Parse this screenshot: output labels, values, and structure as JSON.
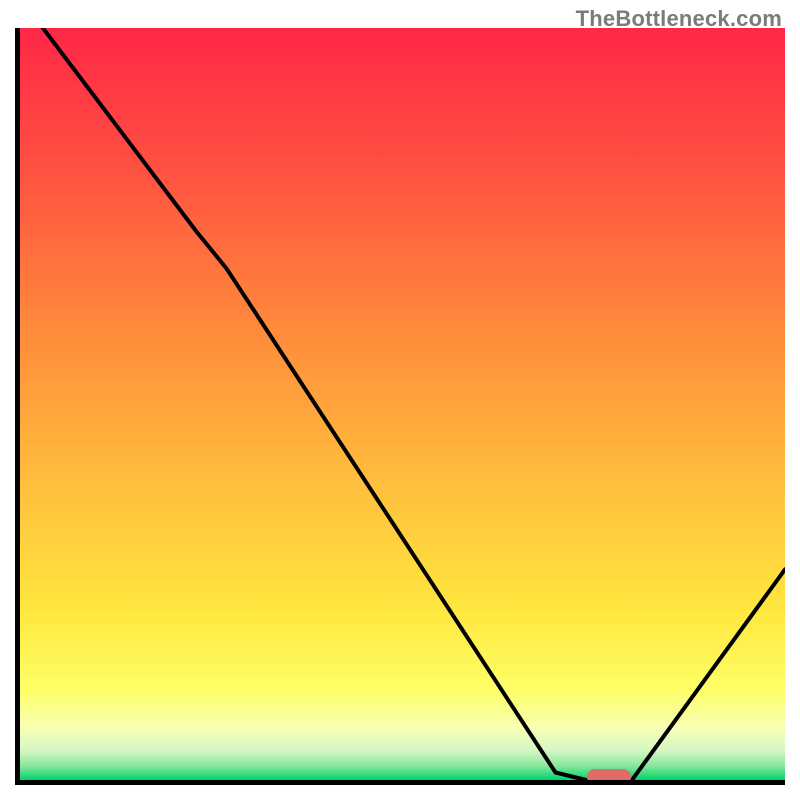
{
  "watermark": "TheBottleneck.com",
  "colors": {
    "axis": "#000000",
    "curve": "#000000",
    "marker": "#e06969",
    "gradient_top": "#ff2747",
    "gradient_mid1": "#ff8a3b",
    "gradient_mid2": "#ffd93f",
    "gradient_mid3": "#ffff55",
    "gradient_mid4": "#f6ffa6",
    "gradient_mid5": "#c9f7b9",
    "gradient_bottom": "#00d46a"
  },
  "chart_data": {
    "type": "line",
    "title": "",
    "xlabel": "",
    "ylabel": "",
    "xlim": [
      0,
      100
    ],
    "ylim": [
      0,
      100
    ],
    "x": [
      0,
      3,
      23,
      27,
      70,
      74,
      80,
      100
    ],
    "values": [
      105,
      100,
      73,
      68,
      1,
      0,
      0,
      28
    ],
    "marker": {
      "x": 77,
      "y": 0,
      "width_pct": 5.7
    },
    "notes": "Background vertical gradient red→orange→yellow→pale→green; single black polyline; small rounded red marker at the valley floor near x≈77."
  }
}
